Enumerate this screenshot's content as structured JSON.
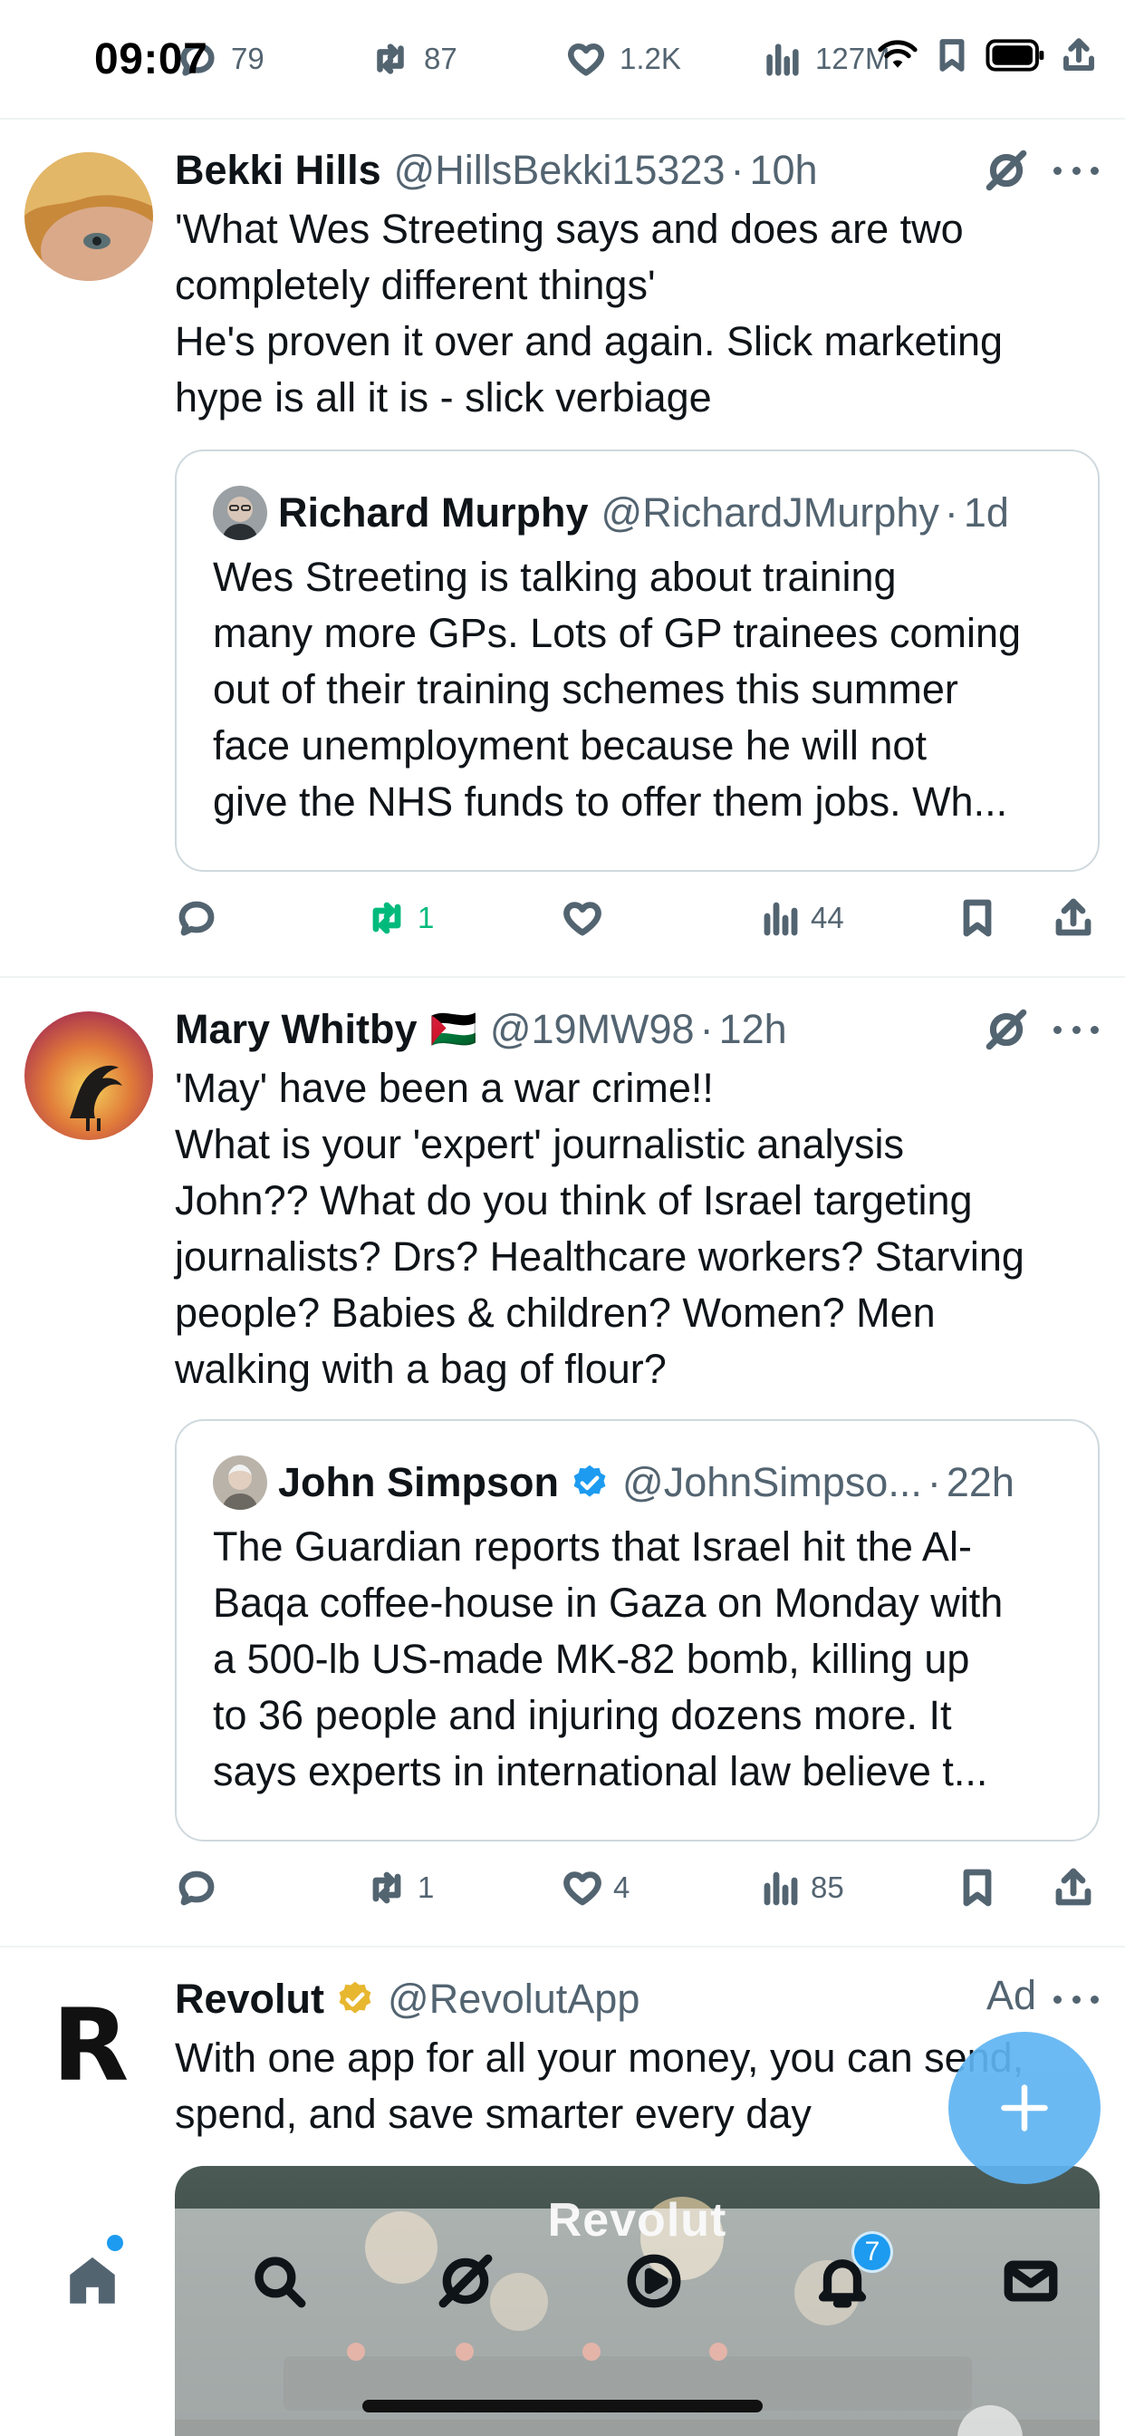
{
  "status_bar": {
    "time": "09:07"
  },
  "top_actions": {
    "replies": "79",
    "reposts": "87",
    "likes": "1.2K",
    "views": "127M"
  },
  "tweets": [
    {
      "name": "Bekki Hills",
      "handle": "@HillsBekki15323",
      "time": "10h",
      "text_lines": [
        "'What Wes Streeting says and does are two",
        "completely different things'",
        "He's proven it over and again. Slick marketing",
        "hype is all it is - slick verbiage"
      ],
      "quote": {
        "name": "Richard Murphy",
        "handle": "@RichardJMurphy",
        "time": "1d",
        "text_lines": [
          "Wes Streeting is talking about training",
          "many more GPs. Lots of GP trainees coming",
          "out of their training schemes this summer",
          "face unemployment because he will not",
          "give the NHS funds to offer them jobs. Wh..."
        ]
      },
      "actions": {
        "replies": "",
        "reposts": "1",
        "likes": "",
        "views": "44"
      }
    },
    {
      "name": "Mary Whitby",
      "flag": "🇵🇸",
      "handle": "@19MW98",
      "time": "12h",
      "text_lines": [
        "'May' have been a war crime!!",
        "What is your 'expert' journalistic analysis",
        "John?? What do you think of Israel targeting",
        "journalists? Drs? Healthcare workers? Starving",
        "people? Babies & children? Women? Men",
        "walking with a bag of flour?"
      ],
      "quote": {
        "name": "John Simpson",
        "handle": "@JohnSimpso...",
        "time": "22h",
        "text_lines": [
          "The Guardian reports that Israel hit the Al-",
          "Baqa coffee-house in Gaza on Monday with",
          "a 500-lb US-made MK-82 bomb, killing up",
          "to 36 people and injuring dozens more.  It",
          "says experts in international law believe t..."
        ]
      },
      "actions": {
        "replies": "",
        "reposts": "1",
        "likes": "4",
        "views": "85"
      }
    }
  ],
  "ad": {
    "name": "Revolut",
    "handle": "@RevolutApp",
    "label": "Ad",
    "text_lines": [
      "With one app for all your money, you can send,",
      "spend, and save smarter every day"
    ],
    "media_logo": "Revolut",
    "logo_letter": "R"
  },
  "bottom_nav": {
    "notification_count": "7"
  },
  "colors": {
    "accent": "#1d9bf0",
    "repost_green": "#00ba7c",
    "secondary_text": "#536471",
    "fab": "#5fb4f2"
  }
}
